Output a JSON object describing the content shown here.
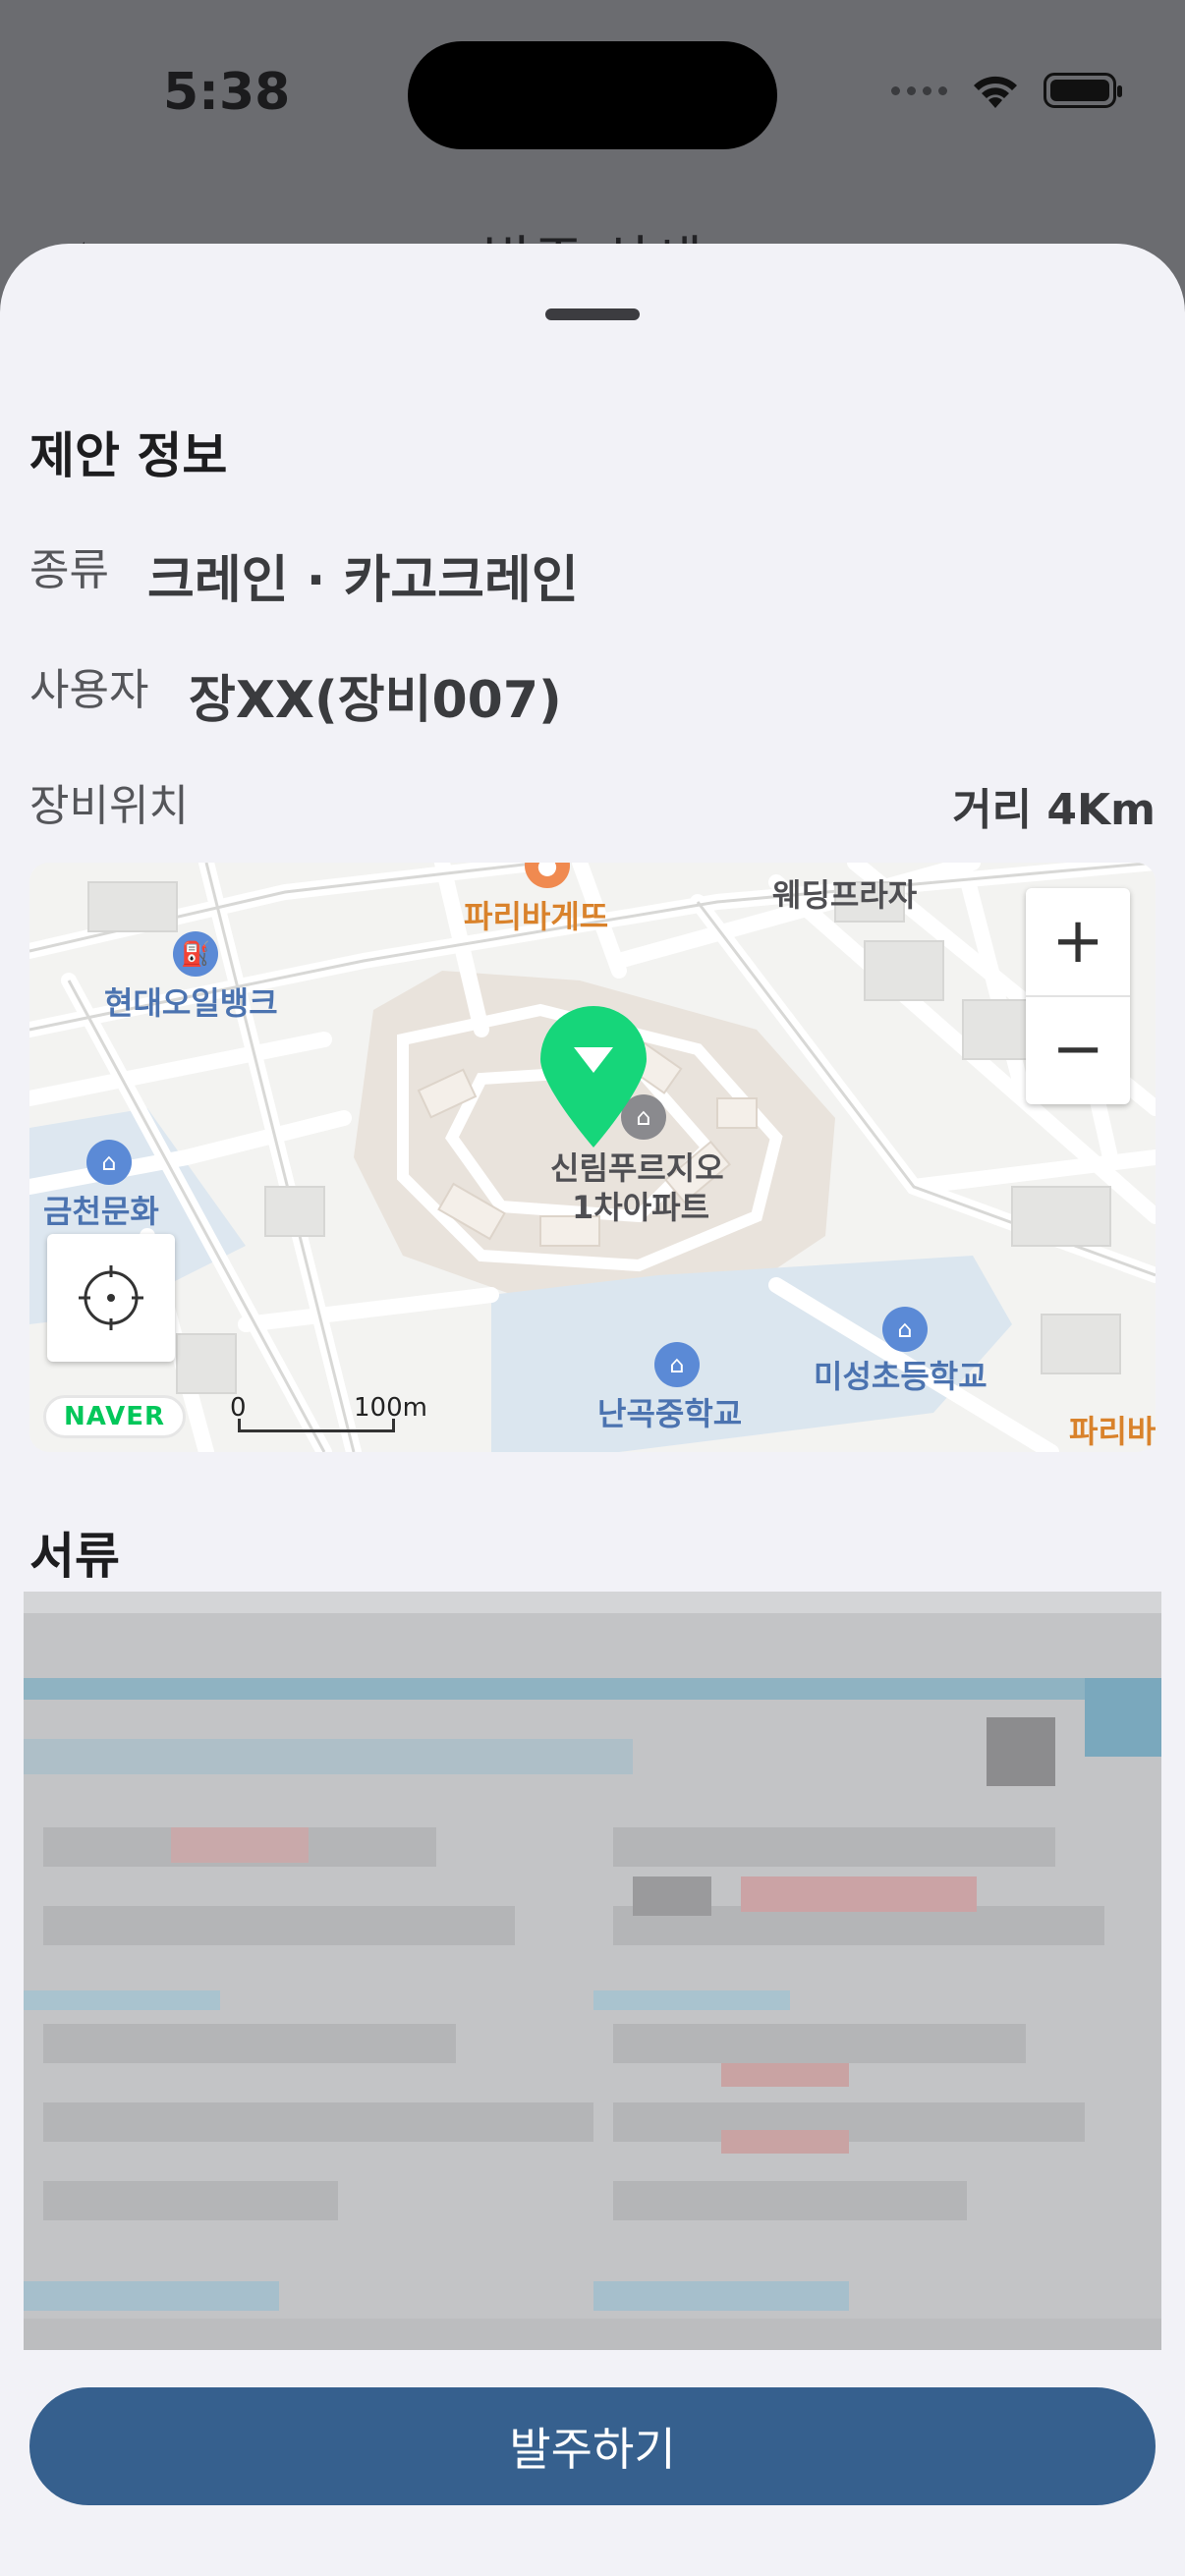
{
  "status_bar": {
    "time": "5:38"
  },
  "background_screen": {
    "title": "발주 상세",
    "back_icon": "chevron-left-icon"
  },
  "proposal": {
    "title": "제안 정보",
    "type_label": "종류",
    "type_value": "크레인 · 카고크레인",
    "user_label": "사용자",
    "user_value": "장XX(장비007)",
    "location_label": "장비위치",
    "distance": "거리 4Km"
  },
  "map": {
    "labels": {
      "parisbaguette_top": "파리바게뜨",
      "wedding_plaza": "웨딩프라자",
      "hyundai_oilbank": "현대오일뱅크",
      "geumcheon": "금천문화",
      "apartment_1": "신림푸르지오",
      "apartment_2": "1차아파트",
      "misung_school": "미성초등학교",
      "nangok_school": "난곡중학교",
      "parisbaguette_right": "파리바"
    },
    "zoom_in": "+",
    "zoom_out": "−",
    "naver_logo": "NAVER",
    "scale_start": "0",
    "scale_end": "100m",
    "pin_color": "#16d67a"
  },
  "documents": {
    "title": "서류"
  },
  "order_button": {
    "label": "발주하기",
    "color": "#36608e"
  }
}
